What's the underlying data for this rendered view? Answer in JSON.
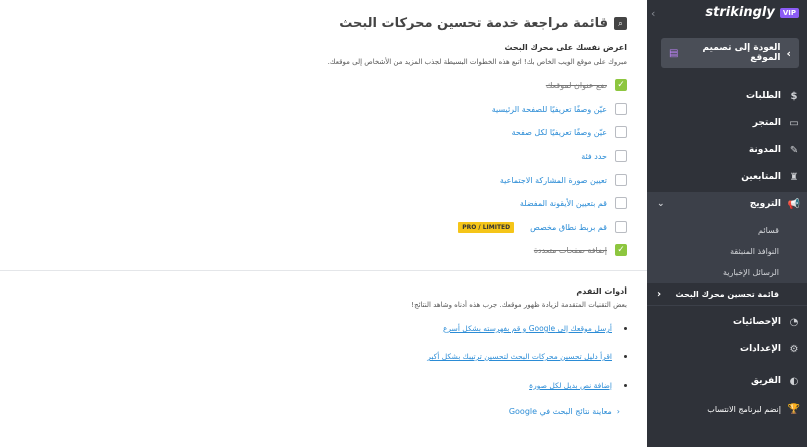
{
  "sidebar": {
    "logo": "strikingly",
    "vip": "VIP",
    "collapse": "›",
    "back_button": "العودة إلى تصميم الموقع",
    "items": [
      {
        "label": "الطلبات",
        "icon": "$"
      },
      {
        "label": "المتجر",
        "icon": "▭"
      },
      {
        "label": "المدونة",
        "icon": "✎"
      },
      {
        "label": "المتابعين",
        "icon": "♜"
      },
      {
        "label": "الترويج",
        "icon": "📢"
      },
      {
        "label": "الإحصائيات",
        "icon": "◔"
      },
      {
        "label": "الإعدادات",
        "icon": "⚙"
      },
      {
        "label": "الفريق",
        "icon": "◐"
      },
      {
        "label": "إنضم لبرنامج الانتساب",
        "icon": "🏆"
      }
    ],
    "promo_sub": [
      {
        "label": "قسائم"
      },
      {
        "label": "النوافذ المنبثقة"
      },
      {
        "label": "الرسائل الإخبارية"
      },
      {
        "label": "قائمة تحسين محرك البحث"
      }
    ]
  },
  "main": {
    "title": "قائمة مراجعة خدمة تحسين محركات البحث",
    "intro_heading": "اعرض نفسك على محرك البحث",
    "intro_text": "مبروك على موقع الويب الخاص بك! اتبع هذه الخطوات البسيطة لجذب المزيد من الأشخاص إلى موقعك.",
    "tasks": [
      {
        "label": "ضع عنوان لموقعك",
        "done": true
      },
      {
        "label": "عيّن وصفًا تعريفيًا للصفحة الرئيسية",
        "done": false
      },
      {
        "label": "عيّن وصفًا تعريفيًا لكل صفحة",
        "done": false
      },
      {
        "label": "حدد فئة",
        "done": false
      },
      {
        "label": "تعيين صورة المشاركة الاجتماعية",
        "done": false
      },
      {
        "label": "قم بتعيين الأيقونة المفضلة",
        "done": false
      },
      {
        "label": "قم بربط نطاق مخصص",
        "done": false,
        "badge": "PRO / LIMITED"
      },
      {
        "label": "إضافة صفحات متعددة",
        "done": true
      }
    ],
    "advanced_heading": "أدوات التقدم",
    "advanced_text": "بعض التقنيات المتقدمة لزيادة ظهور موقعك. جرب هذه أدناه وشاهد النتائج!",
    "links": [
      "أرسل موقعك إلى Google و قم بفهرسته بشكل أسرع",
      "اقرأ دليل تحسين محركات البحث لتحسين ترتيبك بشكل أكبر",
      "إضافة نص بديل لكل صورة"
    ],
    "preview": "معاينة نتائج البحث في Google"
  },
  "colors": {
    "sidebar_bg": "#2f3239",
    "accent_link": "#2b8cd6",
    "check_green": "#8dc63f",
    "badge_yellow": "#f5c518",
    "vip_purple": "#8c5cf6"
  }
}
